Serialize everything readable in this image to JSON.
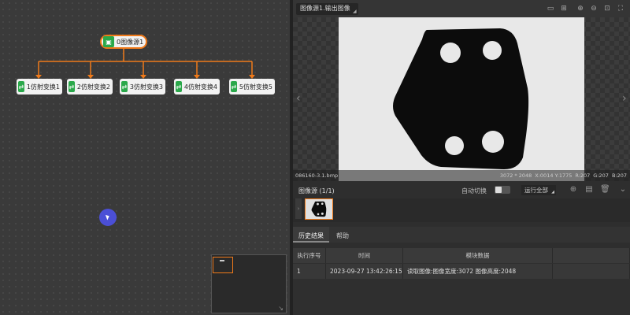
{
  "canvas": {
    "root_node": {
      "label": "0图像源1",
      "icon": "image-icon"
    },
    "child_nodes": [
      {
        "label": "1仿射变换1",
        "icon": "affine-transform-icon"
      },
      {
        "label": "2仿射变换2",
        "icon": "affine-transform-icon"
      },
      {
        "label": "3仿射变换3",
        "icon": "affine-transform-icon"
      },
      {
        "label": "4仿射变换4",
        "icon": "affine-transform-icon"
      },
      {
        "label": "5仿射变换5",
        "icon": "affine-transform-icon"
      }
    ],
    "colors": {
      "wire": "#f07a1a",
      "node_icon": "#2aa84a",
      "cursor": "#4b4fd6"
    }
  },
  "viewer": {
    "view_select": "图像源1.输出图像",
    "toolbar_icons": [
      "fit-icon",
      "crosshair-icon",
      "zoom-in-icon",
      "zoom-out-icon",
      "zoom-fit-icon",
      "fullscreen-icon"
    ],
    "image_file": "086160-3.1.bmp",
    "resolution": "3072 * 2048",
    "coords": "X:0014 Y:1775",
    "rgb_r": "R:207",
    "rgb_g": "G:207",
    "rgb_b": "B:207"
  },
  "source_panel": {
    "title": "图像源 (1/1)",
    "auto_switch_label": "自动切换",
    "run_all_label": "运行全部",
    "icons": [
      "add-icon",
      "folder-icon",
      "delete-icon",
      "collapse-icon"
    ]
  },
  "tabs": [
    {
      "label": "历史结果"
    },
    {
      "label": "帮助"
    }
  ],
  "history": {
    "columns": [
      "执行序号",
      "时间",
      "模块数据"
    ],
    "rows": [
      {
        "index": "1",
        "time": "2023-09-27 13:42:26:159",
        "data": "读取图像:图像宽度:3072 图像高度:2048"
      }
    ]
  }
}
